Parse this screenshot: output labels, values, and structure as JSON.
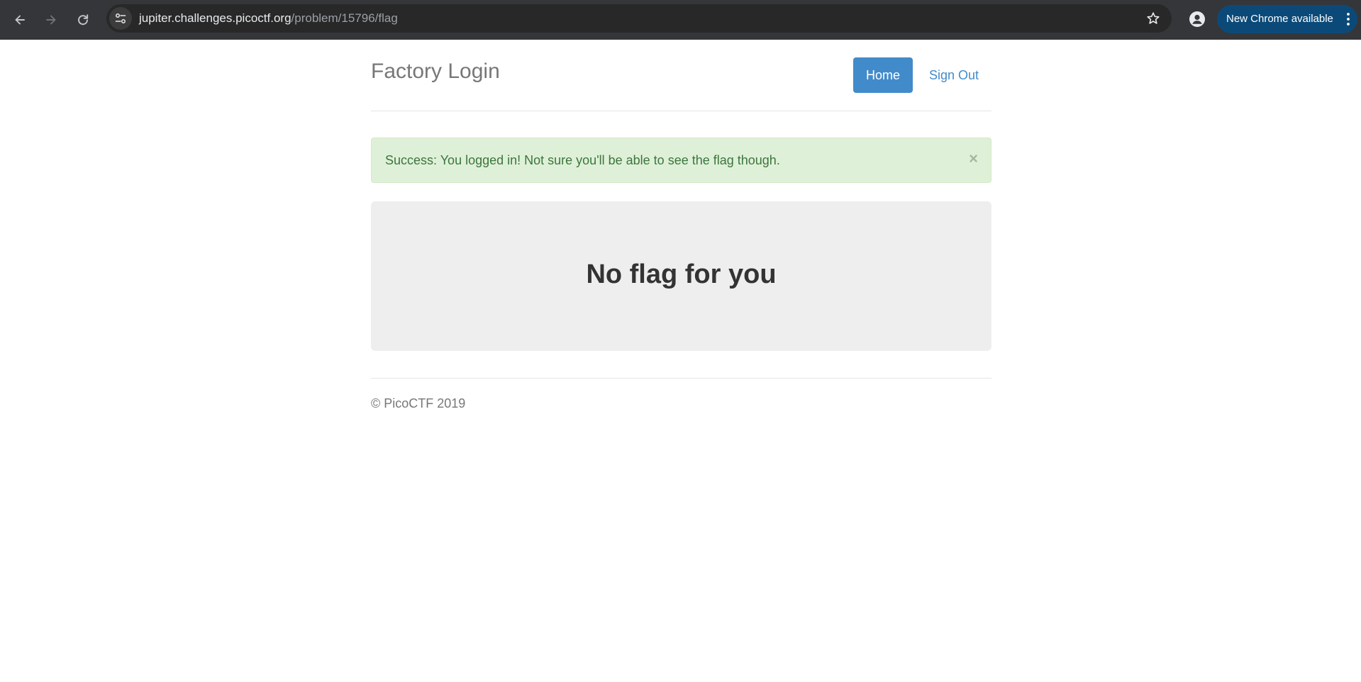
{
  "browser": {
    "url_host": "jupiter.challenges.picoctf.org",
    "url_path": "/problem/15796/flag",
    "update_label": "New Chrome available",
    "icons": {
      "back": "arrow-left-icon",
      "forward": "arrow-right-icon",
      "reload": "reload-icon",
      "site_info": "tune-icon",
      "bookmark": "star-icon",
      "profile": "profile-icon",
      "menu": "kebab-menu-icon"
    },
    "colors": {
      "toolbar": "#35363a",
      "omnibox": "#282828",
      "update_pill": "#0b4a78"
    }
  },
  "page": {
    "brand": "Factory Login",
    "nav": {
      "home": "Home",
      "sign_out": "Sign Out"
    },
    "alert": {
      "message": "Success: You logged in! Not sure you'll be able to see the flag though.",
      "close": "×"
    },
    "jumbotron": {
      "heading": "No flag for you"
    },
    "footer": {
      "text": "© PicoCTF 2019"
    },
    "colors": {
      "primary": "#428bca",
      "alert_bg": "#dff0d8",
      "alert_text": "#3c763d",
      "jumbotron_bg": "#eeeeee"
    }
  }
}
